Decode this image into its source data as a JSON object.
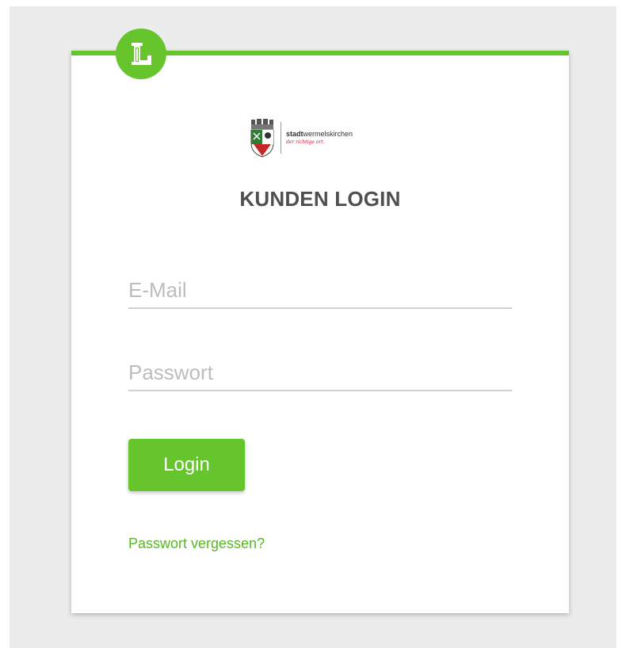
{
  "brand": {
    "badge_letter": "L",
    "accent_color": "#66c42c",
    "org_name_bold": "stadt",
    "org_name_rest": "wermelskirchen",
    "tagline": "der richtige ort."
  },
  "login": {
    "title": "KUNDEN LOGIN",
    "email_placeholder": "E-Mail",
    "password_placeholder": "Passwort",
    "submit_label": "Login",
    "forgot_password_label": "Passwort vergessen?"
  }
}
